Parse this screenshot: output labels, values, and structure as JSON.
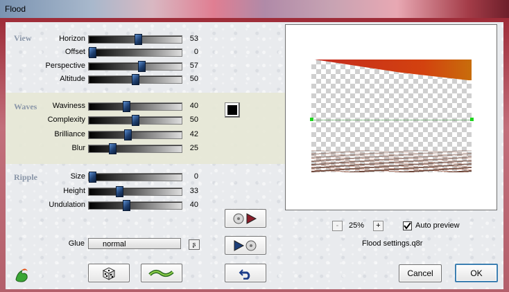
{
  "window": {
    "title": "Flood"
  },
  "groups": {
    "view": "View",
    "waves": "Waves",
    "ripple": "Ripple"
  },
  "sliders": {
    "horizon": {
      "label": "Horizon",
      "value": 53
    },
    "offset": {
      "label": "Offset",
      "value": 0
    },
    "perspective": {
      "label": "Perspective",
      "value": 57
    },
    "altitude": {
      "label": "Altitude",
      "value": 50
    },
    "waviness": {
      "label": "Waviness",
      "value": 40
    },
    "complexity": {
      "label": "Complexity",
      "value": 50
    },
    "brilliance": {
      "label": "Brilliance",
      "value": 42
    },
    "blur": {
      "label": "Blur",
      "value": 25
    },
    "size": {
      "label": "Size",
      "value": 0
    },
    "height": {
      "label": "Height",
      "value": 33
    },
    "undulation": {
      "label": "Undulation",
      "value": 40
    }
  },
  "waves_color": "#000000",
  "glue": {
    "label": "Glue",
    "value": "normal"
  },
  "zoom": {
    "value": "25%",
    "minus": "-",
    "plus": "+"
  },
  "auto_preview": {
    "label": "Auto preview",
    "checked": true
  },
  "settings_file": "Flood settings.q8r",
  "buttons": {
    "cancel": "Cancel",
    "ok": "OK"
  },
  "icons": {
    "app": "flood-app-icon",
    "randomize": "dice-icon",
    "reset": "wave-reset-icon",
    "undo": "undo-icon",
    "load_preset": "load-preset-icon",
    "save_preset": "save-preset-icon",
    "glue_menu": "glue-menu-icon"
  },
  "colors": {
    "accent": "#3c7fb1",
    "wave_band": "#e6e7d6"
  }
}
